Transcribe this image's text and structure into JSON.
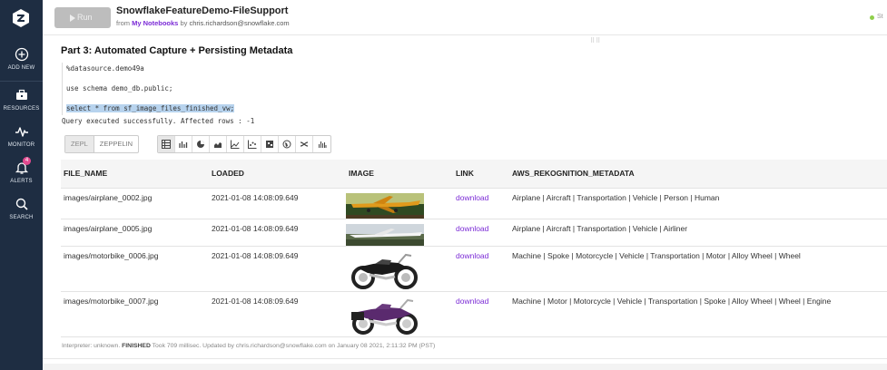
{
  "sidebar": {
    "items": [
      {
        "label": "ADD NEW",
        "icon": "plus-circle-icon"
      },
      {
        "label": "RESOURCES",
        "icon": "briefcase-icon"
      },
      {
        "label": "MONITOR",
        "icon": "pulse-icon"
      },
      {
        "label": "ALERTS",
        "icon": "bell-icon",
        "badge": "4"
      },
      {
        "label": "SEARCH",
        "icon": "search-icon"
      }
    ]
  },
  "header": {
    "run_label": "Run",
    "title": "SnowflakeFeatureDemo-FileSupport",
    "from_label": "from",
    "notebook_link": "My Notebooks",
    "by_label": "by",
    "author": "chris.richardson@snowflake.com",
    "status_text": "St"
  },
  "paragraph": {
    "title": "Part 3: Automated Capture + Persisting Metadata",
    "code_lines": [
      "%datasource.demo49a",
      "use schema demo_db.public;",
      "select * from sf_image_files_finished_vw;"
    ],
    "result_message": "Query executed successfully. Affected rows : -1",
    "modes": [
      "ZEPL",
      "ZEPPELIN"
    ],
    "viz_icons": [
      "table-icon",
      "bar-chart-icon",
      "pie-chart-icon",
      "area-chart-icon",
      "line-chart-icon",
      "scatter-chart-icon",
      "map-icon",
      "globe-icon",
      "network-icon",
      "histogram-icon"
    ]
  },
  "table": {
    "columns": [
      "FILE_NAME",
      "LOADED",
      "IMAGE",
      "LINK",
      "AWS_REKOGNITION_METADATA"
    ],
    "rows": [
      {
        "file": "images/airplane_0002.jpg",
        "loaded": "2021-01-08 14:08:09.649",
        "image": "airplane-photo",
        "link": "download",
        "meta": "Airplane | Aircraft | Transportation | Vehicle | Person | Human"
      },
      {
        "file": "images/airplane_0005.jpg",
        "loaded": "2021-01-08 14:08:09.649",
        "image": "airplane-photo",
        "link": "download",
        "meta": "Airplane | Aircraft | Transportation | Vehicle | Airliner"
      },
      {
        "file": "images/motorbike_0006.jpg",
        "loaded": "2021-01-08 14:08:09.649",
        "image": "motorbike-photo",
        "link": "download",
        "meta": "Machine | Spoke | Motorcycle | Vehicle | Transportation | Motor | Alloy Wheel | Wheel"
      },
      {
        "file": "images/motorbike_0007.jpg",
        "loaded": "2021-01-08 14:08:09.649",
        "image": "motorbike-photo",
        "link": "download",
        "meta": "Machine | Motor | Motorcycle | Vehicle | Transportation | Spoke | Alloy Wheel | Wheel | Engine"
      }
    ]
  },
  "footer": {
    "prefix": "Interpreter: unknown.",
    "status": "FINISHED",
    "details": "Took 709 millisec. Updated by chris.richardson@snowflake.com on January 08 2021, 2:11:32 PM (PST)"
  },
  "colors": {
    "sidebar_bg": "#1e2d42",
    "link": "#7b2bd6",
    "badge": "#e24a8f",
    "status": "#8fcf4c",
    "selection": "#b7d3ee"
  }
}
